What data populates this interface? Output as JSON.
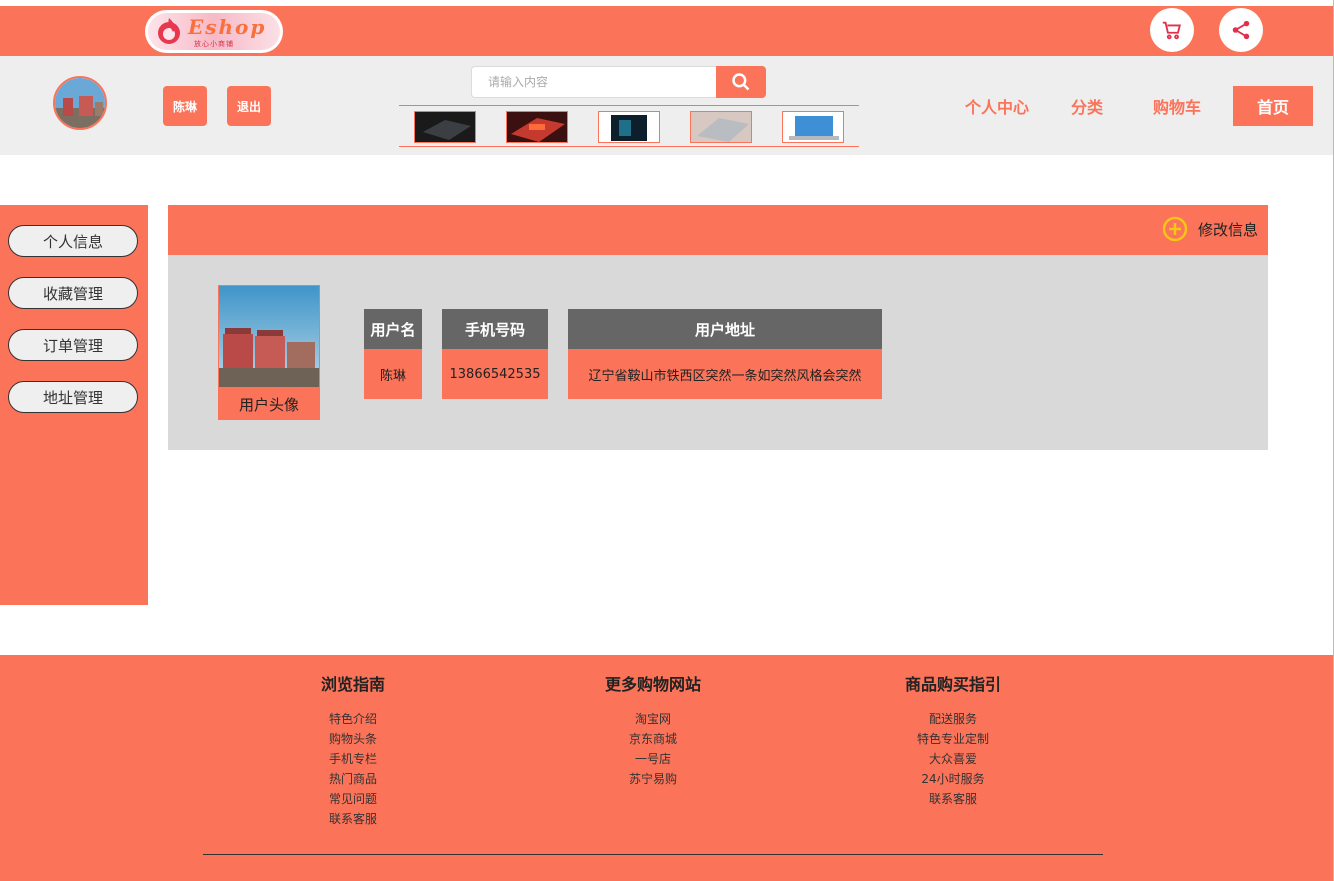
{
  "header": {
    "logo_text": "Eshop",
    "logo_sub": "放心小商铺",
    "cart_icon": "cart-icon",
    "share_icon": "share-icon"
  },
  "nav": {
    "user_name": "陈琳",
    "logout_label": "退出",
    "search_placeholder": "请输入内容",
    "links": [
      "个人中心",
      "分类",
      "购物车"
    ],
    "home_label": "首页"
  },
  "sidebar": {
    "items": [
      "个人信息",
      "收藏管理",
      "订单管理",
      "地址管理"
    ]
  },
  "panel": {
    "edit_label": "修改信息",
    "avatar_caption": "用户头像",
    "columns": [
      {
        "header": "用户名",
        "value": "陈琳"
      },
      {
        "header": "手机号码",
        "value": "13866542535"
      },
      {
        "header": "用户地址",
        "value": "辽宁省鞍山市铁西区突然一条如突然风格会突然"
      }
    ]
  },
  "footer": {
    "columns": [
      {
        "title": "浏览指南",
        "items": [
          "特色介绍",
          "购物头条",
          "手机专栏",
          "热门商品",
          "常见问题",
          "联系客服"
        ]
      },
      {
        "title": "更多购物网站",
        "items": [
          "淘宝网",
          "京东商城",
          "一号店",
          "苏宁易购"
        ]
      },
      {
        "title": "商品购买指引",
        "items": [
          "配送服务",
          "特色专业定制",
          "大众喜爱",
          "24小时服务",
          "联系客服"
        ]
      }
    ]
  },
  "colors": {
    "accent": "#fb7359",
    "nav_bg": "#eeeeee",
    "panel_bg": "#d9d9d9",
    "table_header": "#666666"
  }
}
